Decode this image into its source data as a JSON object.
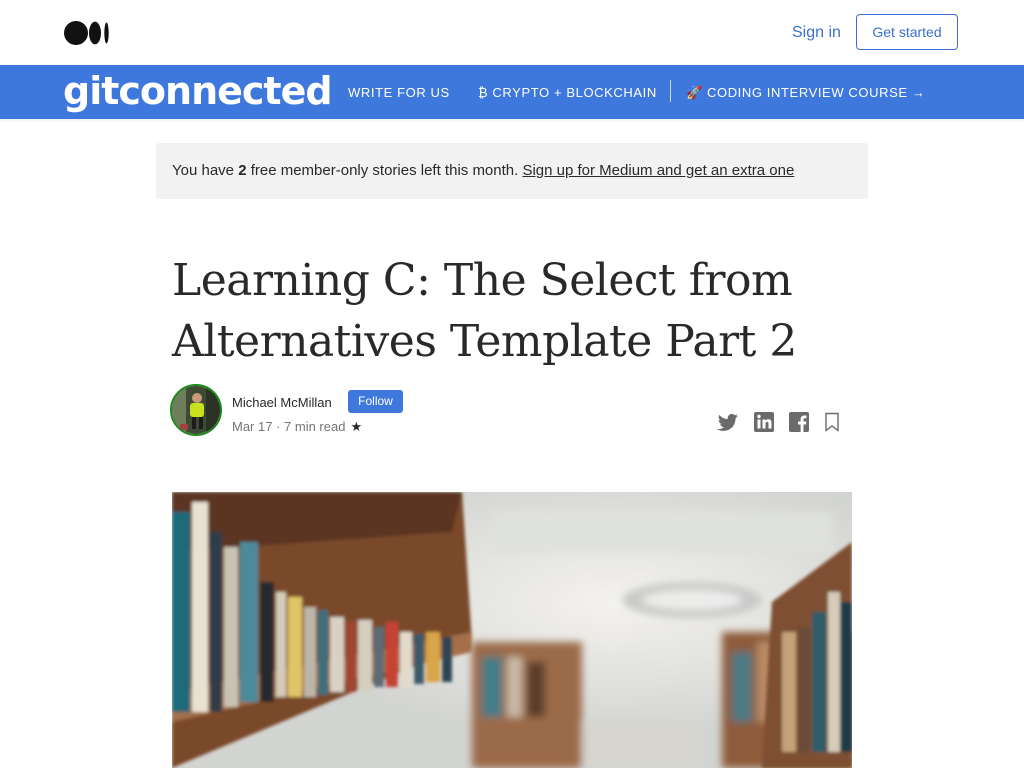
{
  "topbar": {
    "logo_icon": "medium-logo-icon",
    "sign_in": "Sign in",
    "get_started": "Get started"
  },
  "publication": {
    "brand": "gitconnected",
    "nav": [
      {
        "label": "WRITE FOR US"
      },
      {
        "label": "₿ CRYPTO + BLOCKCHAIN"
      },
      {
        "label": "🚀 CODING INTERVIEW COURSE →"
      }
    ],
    "color": "#3f78dd"
  },
  "banner": {
    "prefix": "You have ",
    "count": "2",
    "suffix": " free member-only stories left this month. ",
    "link": "Sign up for Medium and get an extra one"
  },
  "article": {
    "title": "Learning C: The Select from Alternatives Template Part 2",
    "author": "Michael McMillan",
    "follow": "Follow",
    "date": "Mar 17",
    "read_time": "7 min read",
    "member_star": "★",
    "share_icons": [
      "twitter-icon",
      "linkedin-icon",
      "facebook-icon",
      "bookmark-icon"
    ]
  }
}
